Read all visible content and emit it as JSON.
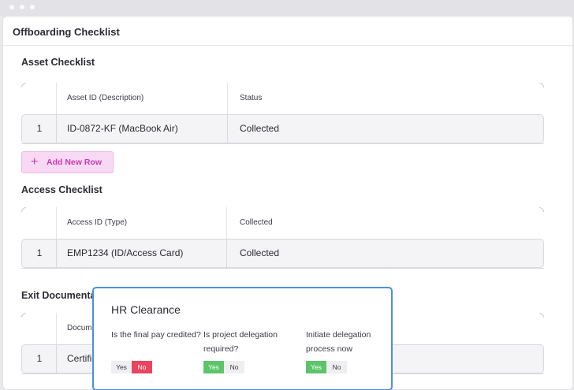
{
  "panel_title": "Offboarding Checklist",
  "sections": {
    "asset": {
      "title": "Asset Checklist",
      "headers": [
        "Asset ID (Description)",
        "Status"
      ],
      "rows": [
        {
          "index": "1",
          "id": "ID-0872-KF (MacBook Air)",
          "value": "Collected"
        }
      ],
      "add_button": "Add New Row"
    },
    "access": {
      "title": "Access Checklist",
      "headers": [
        "Access ID (Type)",
        "Collected"
      ],
      "rows": [
        {
          "index": "1",
          "id": "EMP1234 (ID/Access Card)",
          "value": "Collected"
        }
      ]
    },
    "exit": {
      "title": "Exit Documenta",
      "headers": [
        "Docum"
      ],
      "rows": [
        {
          "index": "1",
          "id": "Certifi"
        }
      ]
    }
  },
  "modal": {
    "title": "HR Clearance",
    "questions": [
      {
        "text": "Is the final pay credited?",
        "yes": "Yes",
        "no": "No",
        "selected": "No"
      },
      {
        "text": "Is project delegation required?",
        "yes": "Yes",
        "no": "No",
        "selected": "Yes"
      },
      {
        "text": "Initiate delegation process now",
        "yes": "Yes",
        "no": "No",
        "selected": "Yes"
      }
    ]
  },
  "colors": {
    "accent": "#4a90e2",
    "add_button_bg": "#f8d9f3",
    "add_button_text": "#c83bb3",
    "yes_selected": "#5dc46a",
    "no_selected": "#e8455f"
  }
}
